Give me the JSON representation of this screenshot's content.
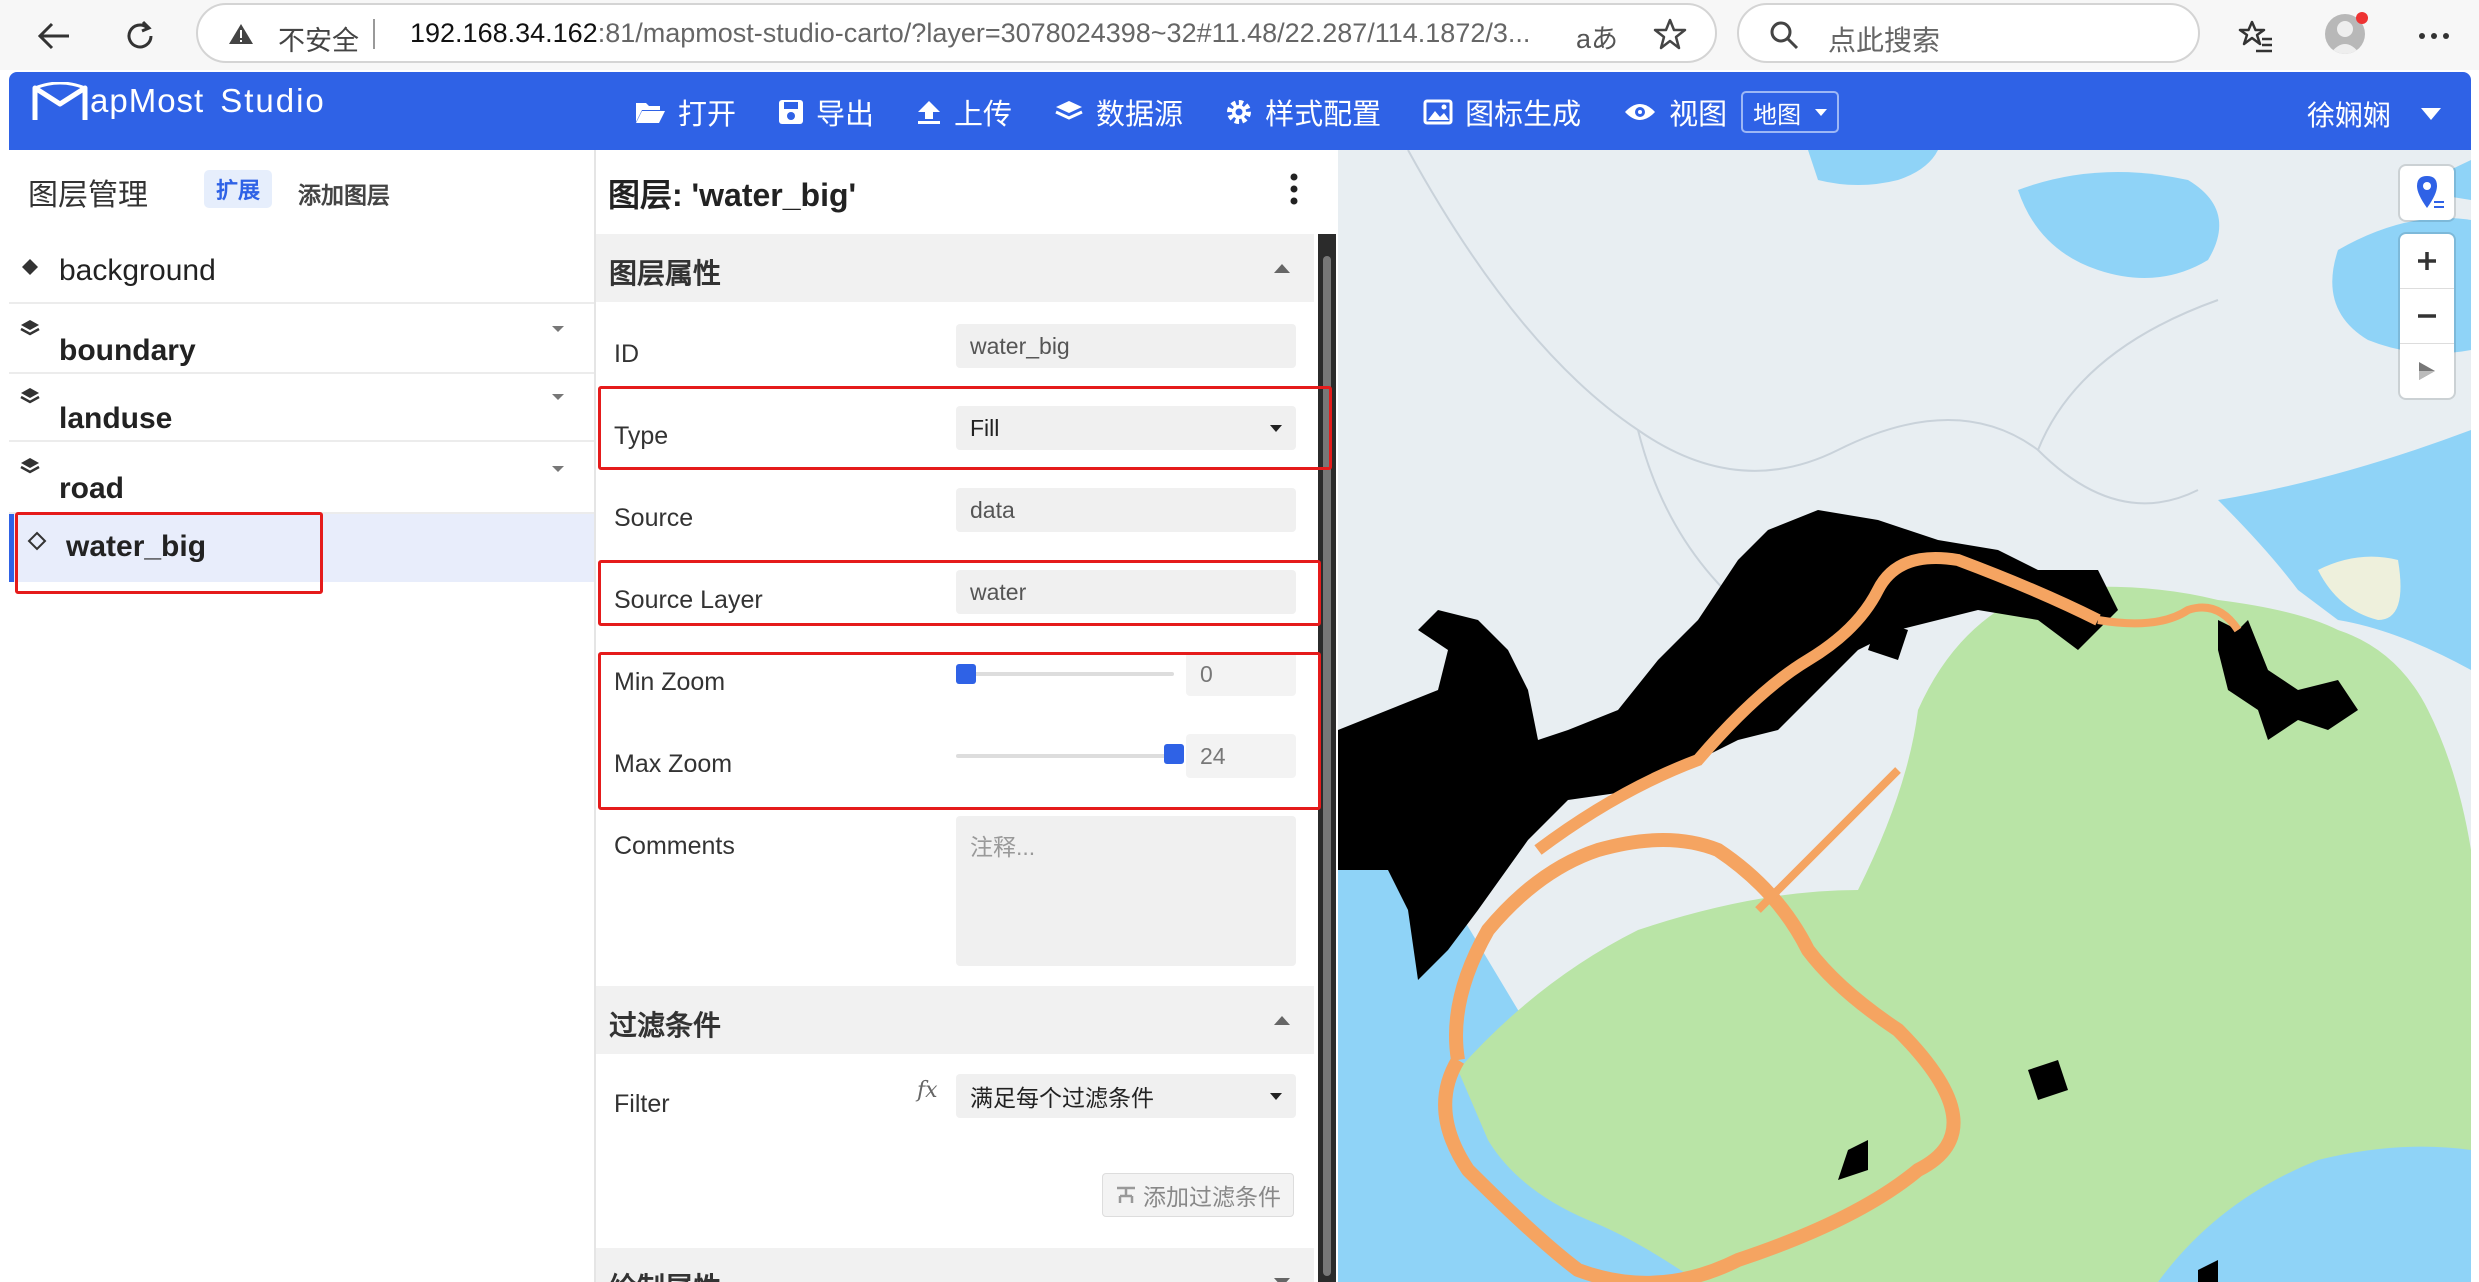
{
  "browser": {
    "insecure_label": "不安全",
    "url_host": "192.168.34.162",
    "url_rest": ":81/mapmost-studio-carto/?layer=3078024398~32#11.48/22.287/114.1872/3...",
    "read_aloud": "aあ",
    "search_placeholder": "点此搜索"
  },
  "header": {
    "logo_text": "apMost",
    "logo_suffix": "Studio",
    "nav": [
      {
        "label": "打开",
        "icon": "folder-open-icon"
      },
      {
        "label": "导出",
        "icon": "save-icon"
      },
      {
        "label": "上传",
        "icon": "upload-icon"
      },
      {
        "label": "数据源",
        "icon": "layers-icon"
      },
      {
        "label": "样式配置",
        "icon": "gear-icon"
      },
      {
        "label": "图标生成",
        "icon": "image-icon"
      },
      {
        "label": "视图",
        "icon": "eye-icon"
      }
    ],
    "view_select": "地图",
    "user_name": "徐娴娴"
  },
  "layer_panel": {
    "title": "图层管理",
    "expand_label": "扩展",
    "add_layer_label": "添加图层",
    "layers": [
      {
        "name": "background",
        "icon": "diamond-fill-icon",
        "group": false
      },
      {
        "name": "boundary",
        "icon": "layers-stack-icon",
        "group": true
      },
      {
        "name": "landuse",
        "icon": "layers-stack-icon",
        "group": true
      },
      {
        "name": "road",
        "icon": "layers-stack-icon",
        "group": true
      },
      {
        "name": "water_big",
        "icon": "diamond-outline-icon",
        "group": false,
        "active": true
      }
    ]
  },
  "editor": {
    "title": "图层: 'water_big'",
    "sections": {
      "properties": "图层属性",
      "filter": "过滤条件",
      "paint": "绘制属性"
    },
    "fields": {
      "id_label": "ID",
      "id_value": "water_big",
      "type_label": "Type",
      "type_value": "Fill",
      "source_label": "Source",
      "source_value": "data",
      "source_layer_label": "Source Layer",
      "source_layer_value": "water",
      "min_zoom_label": "Min Zoom",
      "min_zoom_value": "0",
      "max_zoom_label": "Max Zoom",
      "max_zoom_value": "24",
      "comments_label": "Comments",
      "comments_placeholder": "注释...",
      "filter_label": "Filter",
      "filter_fx": "fx",
      "filter_value": "满足每个过滤条件",
      "add_filter_label": "添加过滤条件"
    },
    "zoom": {
      "min": 0,
      "max": 24,
      "range_min": 0,
      "range_max": 24
    }
  },
  "colors": {
    "brand": "#2f62e6",
    "highlight": "#e51b1b",
    "map_water": "#8fd3f7",
    "map_land": "#b9e4a6",
    "map_road": "#f5a461",
    "map_layer_fill": "#000000"
  }
}
